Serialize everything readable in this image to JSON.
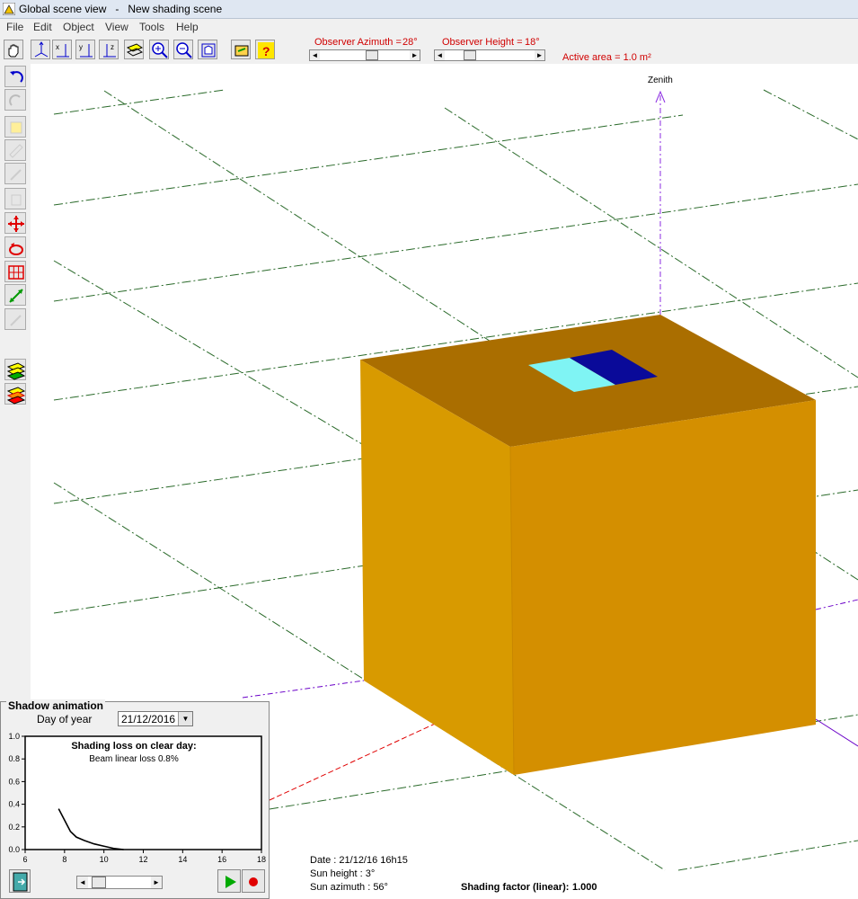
{
  "window": {
    "title": "Global scene view   -   New shading scene"
  },
  "menu": [
    "File",
    "Edit",
    "Object",
    "View",
    "Tools",
    "Help"
  ],
  "toolbar": {
    "observer_azimuth_label": "Observer Azimuth =",
    "observer_azimuth_value": "28°",
    "observer_height_label": "Observer Height =",
    "observer_height_value": "18°",
    "active_area": "Active area = 1.0 m²"
  },
  "scene": {
    "zenith_label": "Zenith",
    "colors": {
      "box_top": "#aa6e00",
      "box_left": "#d89a00",
      "box_right": "#d48f00",
      "panel_light": "#7ff4f4",
      "panel_dark": "#0a0a99",
      "grid": "#2a6a2a"
    }
  },
  "animation": {
    "panel_title": "Shadow animation",
    "day_label": "Day of year",
    "date_value": "21/12/2016"
  },
  "chart_data": {
    "type": "line",
    "title": "Shading loss on clear day:",
    "subtitle": "Beam linear loss 0.8%",
    "x": [
      7.7,
      8.0,
      8.3,
      8.6,
      9.0,
      9.5,
      10.0,
      10.5,
      11.0
    ],
    "y": [
      0.36,
      0.26,
      0.16,
      0.11,
      0.08,
      0.05,
      0.03,
      0.01,
      0.0
    ],
    "xlim": [
      6,
      18
    ],
    "ylim": [
      0,
      1.0
    ],
    "x_ticks": [
      "6",
      "8",
      "10",
      "12",
      "14",
      "16",
      "18"
    ],
    "y_ticks": [
      "0.0",
      "0.2",
      "0.4",
      "0.6",
      "0.8",
      "1.0"
    ],
    "grid": false
  },
  "status": {
    "date": "Date :  21/12/16 16h15",
    "sun_height": "Sun height : 3°",
    "sun_azimuth": "Sun azimuth : 56°",
    "shading_factor_label": "Shading factor (linear):",
    "shading_factor_value": "1.000"
  }
}
